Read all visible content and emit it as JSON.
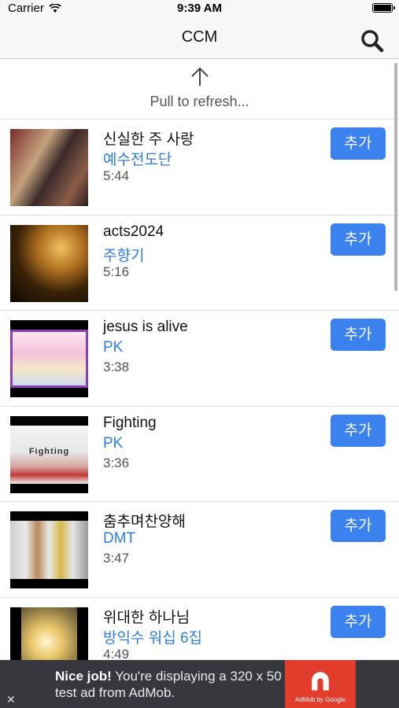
{
  "status_bar": {
    "carrier": "Carrier",
    "time": "9:39 AM"
  },
  "nav": {
    "title": "CCM"
  },
  "refresh": {
    "label": "Pull to refresh..."
  },
  "songs": [
    {
      "title": "신실한 주 사랑",
      "artist": "예수전도단",
      "duration": "5:44",
      "button": "추가"
    },
    {
      "title": "acts2024",
      "artist": "주향기",
      "duration": "5:16",
      "button": "추가"
    },
    {
      "title": "jesus is alive",
      "artist": "PK",
      "duration": "3:38",
      "button": "추가"
    },
    {
      "title": "Fighting",
      "artist": "PK",
      "duration": "3:36",
      "button": "추가",
      "thumb_caption": "Fighting"
    },
    {
      "title": "춤추며찬양해",
      "artist": "DMT",
      "duration": "3:47",
      "button": "추가"
    },
    {
      "title": "위대한 하나님",
      "artist": "방익수 워십 6집",
      "duration": "4:49",
      "button": "추가"
    }
  ],
  "ad": {
    "headline": "Nice job!",
    "body": " You're displaying a 320 x 50 test ad from AdMob.",
    "logo_caption": "AdMob by Google",
    "close": "✕"
  },
  "colors": {
    "accent": "#3b82ef",
    "artist": "#2f7ee6",
    "ad_bg": "#37383d",
    "ad_logo": "#e23c2d"
  }
}
